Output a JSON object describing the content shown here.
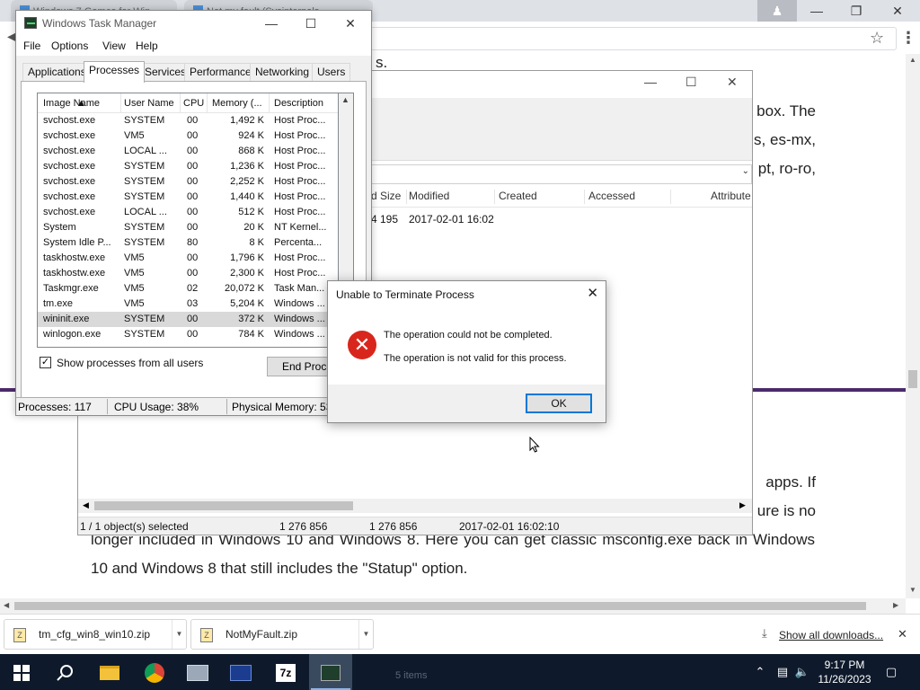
{
  "browser": {
    "tabs": [
      {
        "label": "Windows 7 Games for Win..."
      },
      {
        "label": "Not my fault (Sysinternals..."
      }
    ],
    "article": {
      "line1_tail": "s.",
      "p1": [
        "box. The",
        "s, es-mx,",
        "pt, ro-ro,"
      ],
      "p2_right": [
        "apps. If",
        "ure is no"
      ],
      "p2_full": "longer included in Windows 10 and Windows 8. Here you can get classic msconfig.exe back in Windows 10 and Windows 8 that still includes the \"Statup\" option."
    }
  },
  "explorer": {
    "columns": [
      "d Size",
      "Modified",
      "Created",
      "Accessed",
      "Attribute"
    ],
    "row": {
      "size": "4 195",
      "modified": "2017-02-01 16:02"
    },
    "status": [
      "1 / 1 object(s) selected",
      "1 276 856",
      "1 276 856",
      "2017-02-01 16:02:10"
    ]
  },
  "taskmgr": {
    "title": "Windows Task Manager",
    "menu": [
      "File",
      "Options",
      "View",
      "Help"
    ],
    "tabs": [
      "Applications",
      "Processes",
      "Services",
      "Performance",
      "Networking",
      "Users"
    ],
    "active_tab": "Processes",
    "columns": [
      "Image Name",
      "User Name",
      "CPU",
      "Memory (...",
      "Description"
    ],
    "processes": [
      {
        "name": "svchost.exe",
        "user": "SYSTEM",
        "cpu": "00",
        "mem": "1,492 K",
        "desc": "Host Proc..."
      },
      {
        "name": "svchost.exe",
        "user": "VM5",
        "cpu": "00",
        "mem": "924 K",
        "desc": "Host Proc..."
      },
      {
        "name": "svchost.exe",
        "user": "LOCAL ...",
        "cpu": "00",
        "mem": "868 K",
        "desc": "Host Proc..."
      },
      {
        "name": "svchost.exe",
        "user": "SYSTEM",
        "cpu": "00",
        "mem": "1,236 K",
        "desc": "Host Proc..."
      },
      {
        "name": "svchost.exe",
        "user": "SYSTEM",
        "cpu": "00",
        "mem": "2,252 K",
        "desc": "Host Proc..."
      },
      {
        "name": "svchost.exe",
        "user": "SYSTEM",
        "cpu": "00",
        "mem": "1,440 K",
        "desc": "Host Proc..."
      },
      {
        "name": "svchost.exe",
        "user": "LOCAL ...",
        "cpu": "00",
        "mem": "512 K",
        "desc": "Host Proc..."
      },
      {
        "name": "System",
        "user": "SYSTEM",
        "cpu": "00",
        "mem": "20 K",
        "desc": "NT Kernel..."
      },
      {
        "name": "System Idle P...",
        "user": "SYSTEM",
        "cpu": "80",
        "mem": "8 K",
        "desc": "Percenta..."
      },
      {
        "name": "taskhostw.exe",
        "user": "VM5",
        "cpu": "00",
        "mem": "1,796 K",
        "desc": "Host Proc..."
      },
      {
        "name": "taskhostw.exe",
        "user": "VM5",
        "cpu": "00",
        "mem": "2,300 K",
        "desc": "Host Proc..."
      },
      {
        "name": "Taskmgr.exe",
        "user": "VM5",
        "cpu": "02",
        "mem": "20,072 K",
        "desc": "Task Man..."
      },
      {
        "name": "tm.exe",
        "user": "VM5",
        "cpu": "03",
        "mem": "5,204 K",
        "desc": "Windows ..."
      },
      {
        "name": "wininit.exe",
        "user": "SYSTEM",
        "cpu": "00",
        "mem": "372 K",
        "desc": "Windows ...",
        "selected": true
      },
      {
        "name": "winlogon.exe",
        "user": "SYSTEM",
        "cpu": "00",
        "mem": "784 K",
        "desc": "Windows ..."
      }
    ],
    "show_all_label": "Show processes from all users",
    "show_all_checked": true,
    "end_process_label": "End Process",
    "status": {
      "processes": "Processes: 117",
      "cpu": "CPU Usage: 38%",
      "memory": "Physical Memory: 53%"
    }
  },
  "dialog": {
    "title": "Unable to Terminate Process",
    "message1": "The operation could not be completed.",
    "message2": "The operation is not valid for this process.",
    "ok_label": "OK"
  },
  "downloads": {
    "items": [
      "tm_cfg_win8_win10.zip",
      "NotMyFault.zip"
    ],
    "show_all_label": "Show all downloads..."
  },
  "taskbar": {
    "ghost_text": "5 items",
    "time": "9:17 PM",
    "date": "11/26/2023"
  },
  "colors": {
    "accent": "#0078d7",
    "error": "#d9261c",
    "taskbar": "#0e1a2b",
    "article_rule": "#4b2a6b"
  }
}
